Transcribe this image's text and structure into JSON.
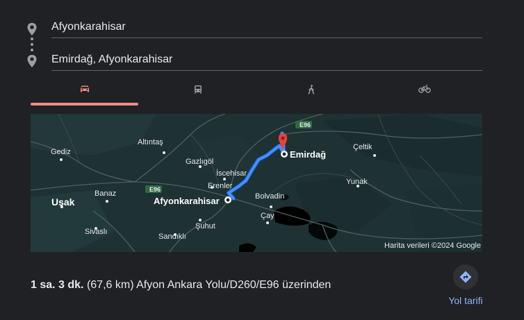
{
  "route": {
    "origin": "Afyonkarahisar",
    "destination": "Emirdağ, Afyonkarahisar"
  },
  "tabs": [
    {
      "name": "car",
      "icon": "car-icon",
      "active": true
    },
    {
      "name": "transit",
      "icon": "transit-icon",
      "active": false
    },
    {
      "name": "walk",
      "icon": "walk-icon",
      "active": false
    },
    {
      "name": "bike",
      "icon": "bike-icon",
      "active": false
    }
  ],
  "map": {
    "labels": {
      "gediz": "Gediz",
      "altintas": "Altıntaş",
      "gazligol": "Gazlıgöl",
      "iscehisar": "İscehisar",
      "erenler": "Erenler",
      "banaz": "Banaz",
      "usak": "Uşak",
      "afyonkarahisar": "Afyonkarahisar",
      "emirdag": "Emirdağ",
      "celtik": "Çeltik",
      "yunak": "Yunak",
      "bolvadin": "Bolvadin",
      "cay": "Çay",
      "sivasli": "Sivaslı",
      "suhut": "Şuhut",
      "sandikli": "Sandıklı",
      "e96_left": "E96",
      "e96_top": "E96"
    },
    "attribution": "Harita verileri ©2024 Google",
    "colors": {
      "route": "#1a73e8",
      "pin": "#ea4335",
      "land": "#1e3133"
    }
  },
  "summary": {
    "duration": "1 sa. 3 dk.",
    "detail": "(67,6 km) Afyon Ankara Yolu/D260/E96 üzerinden"
  },
  "directions": {
    "label": "Yol tarifi",
    "icon": "directions-icon"
  }
}
